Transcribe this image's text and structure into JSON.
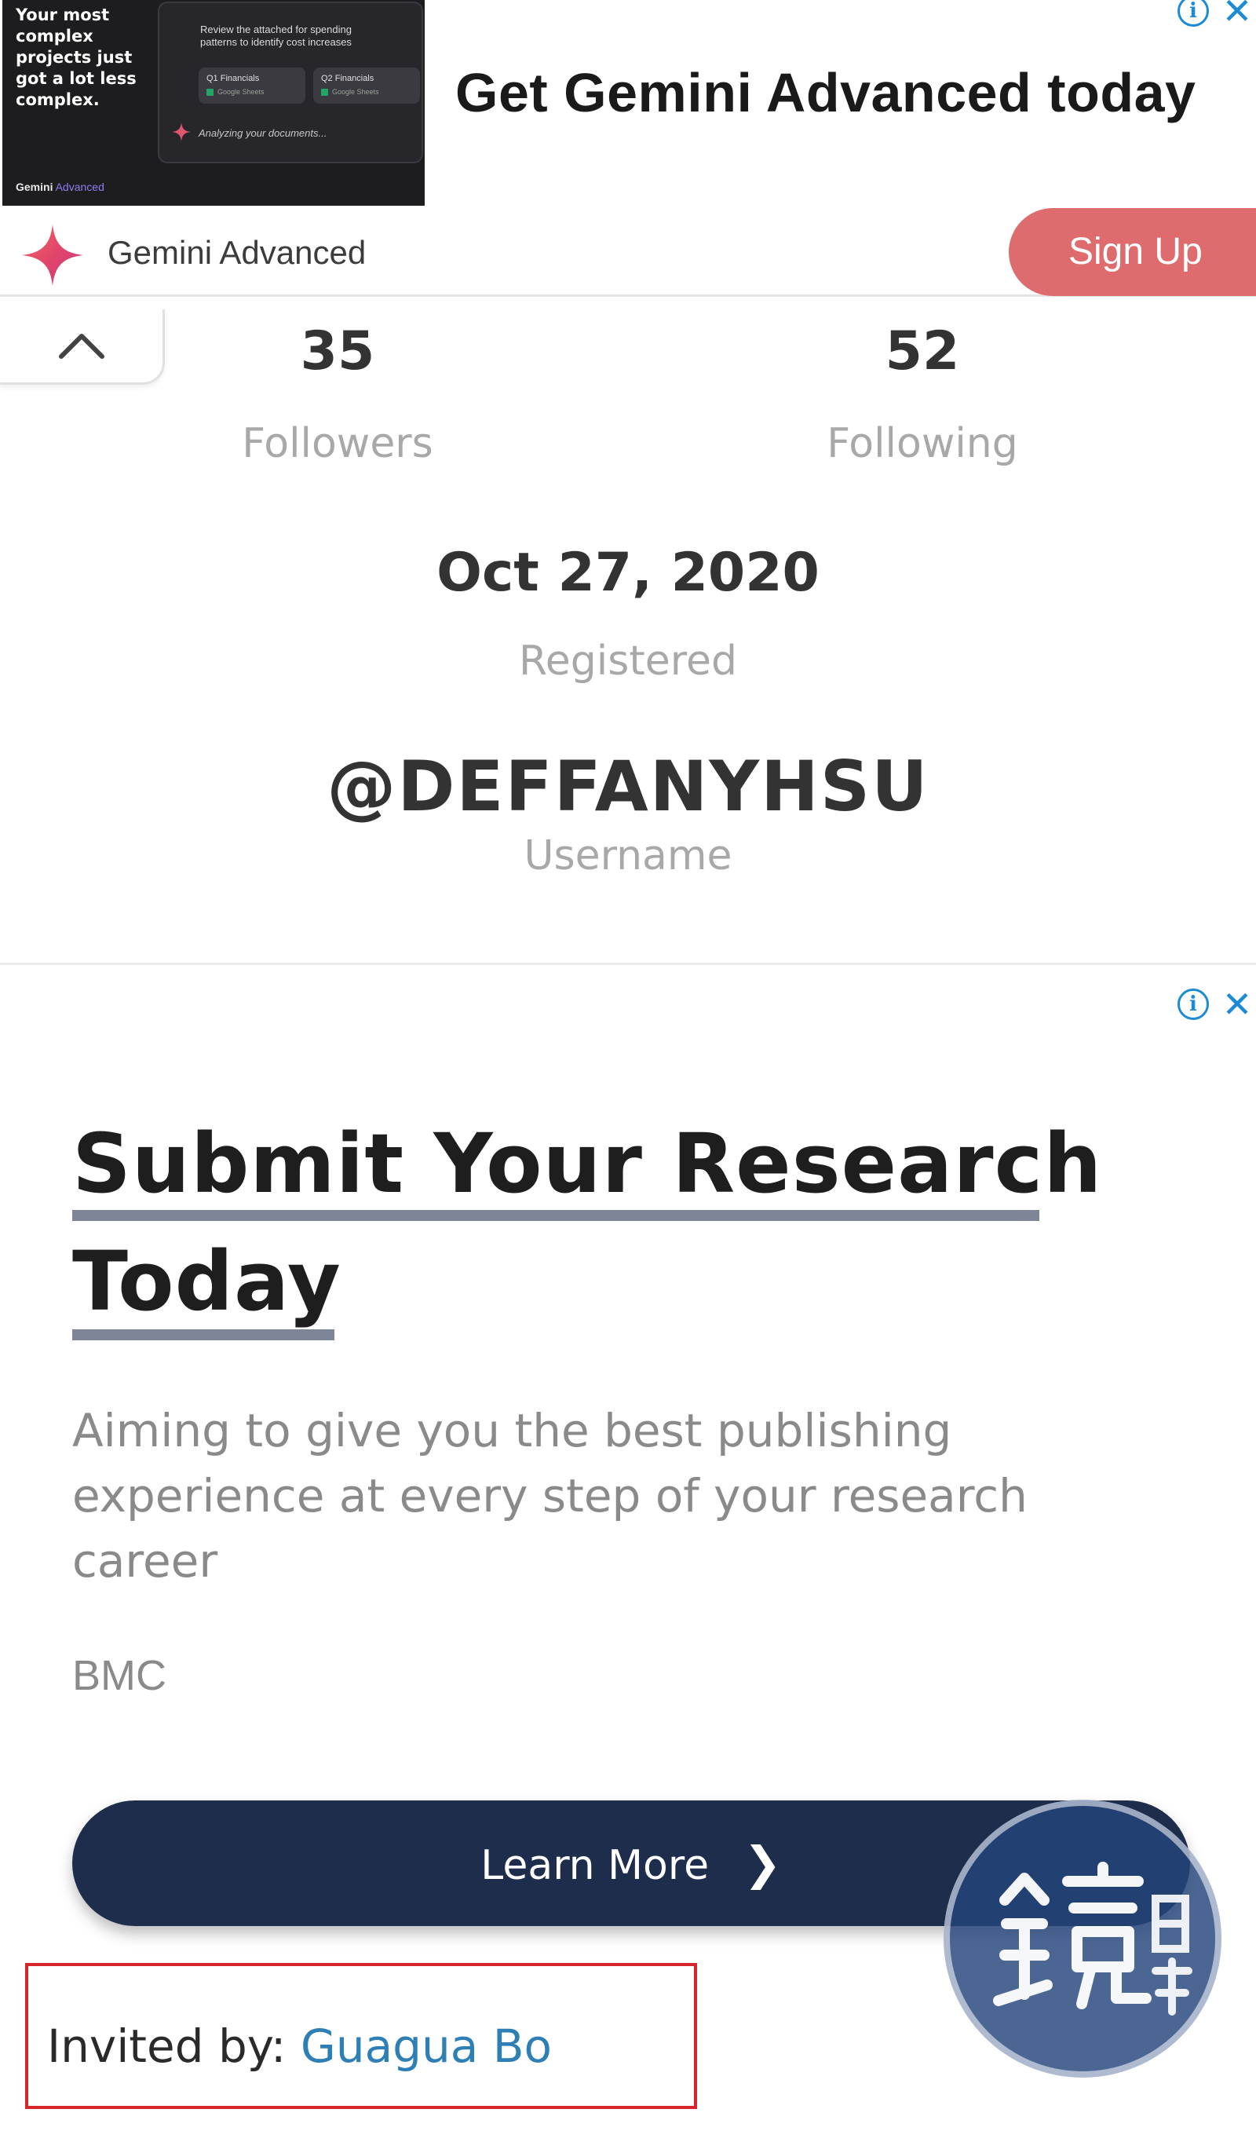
{
  "top_ad": {
    "thumbnail": {
      "headline": "Your most complex projects just got a lot less complex.",
      "prompt": "Review the attached for spending patterns to identify cost increases",
      "file_cards": [
        {
          "title": "Q1 Financials",
          "subtitle": "Google Sheets"
        },
        {
          "title": "Q2 Financials",
          "subtitle": "Google Sheets"
        }
      ],
      "status": "Analyzing your documents...",
      "brand": "Gemini",
      "brand_suffix": "Advanced"
    },
    "headline": "Get Gemini Advanced today",
    "advertiser": "Gemini Advanced",
    "cta": "Sign Up",
    "info_icon": "i",
    "close_icon": "✕"
  },
  "profile": {
    "collapse_icon": "chevron-up-icon",
    "followers_count": "35",
    "followers_label": "Followers",
    "following_count": "52",
    "following_label": "Following",
    "registered_date": "Oct 27, 2020",
    "registered_label": "Registered",
    "username": "@DEFFANYHSU",
    "username_label": "Username"
  },
  "bmc_ad": {
    "title_line1": "Submit Your Research",
    "title_line2": "Today",
    "body": "Aiming to give you the best publishing experience at every step of your research career",
    "advertiser": "BMC",
    "cta": "Learn More",
    "cta_chevron": "❯",
    "info_icon": "i",
    "close_icon": "✕"
  },
  "invited": {
    "label": "Invited by: ",
    "inviter": "Guagua Bo"
  },
  "colors": {
    "signup_button": "#de6c6e",
    "learn_more_button": "#1e2d4c",
    "inviter_link": "#2d7fb5",
    "highlight_box": "#d6262b",
    "ad_choices": "#1b8bd6"
  }
}
